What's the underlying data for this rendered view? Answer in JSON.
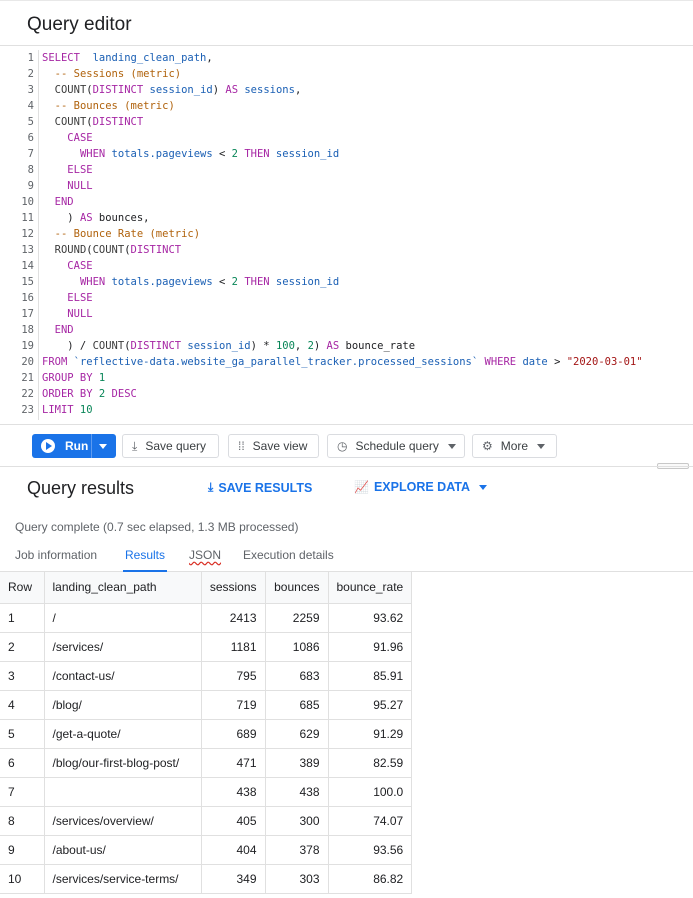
{
  "editor": {
    "title": "Query editor"
  },
  "sql": [
    [
      [
        "k",
        "SELECT"
      ],
      [
        "",
        "  "
      ],
      [
        "id",
        "landing_clean_path"
      ],
      [
        "",
        ","
      ]
    ],
    [
      [
        "",
        "  "
      ],
      [
        "c",
        "-- Sessions (metric)"
      ]
    ],
    [
      [
        "",
        "  "
      ],
      [
        "f",
        "COUNT"
      ],
      [
        "",
        "("
      ],
      [
        "k",
        "DISTINCT"
      ],
      [
        "",
        ""
      ],
      [
        "id",
        " session_id"
      ],
      [
        "",
        ") "
      ],
      [
        "k",
        "AS"
      ],
      [
        "id",
        " sessions"
      ],
      [
        "",
        ","
      ]
    ],
    [
      [
        "",
        "  "
      ],
      [
        "c",
        "-- Bounces (metric)"
      ]
    ],
    [
      [
        "",
        "  "
      ],
      [
        "f",
        "COUNT"
      ],
      [
        "",
        "("
      ],
      [
        "k",
        "DISTINCT"
      ]
    ],
    [
      [
        "",
        "    "
      ],
      [
        "k",
        "CASE"
      ]
    ],
    [
      [
        "",
        "      "
      ],
      [
        "k",
        "WHEN"
      ],
      [
        "id",
        " totals.pageviews"
      ],
      [
        "",
        " < "
      ],
      [
        "n",
        "2"
      ],
      [
        "",
        ""
      ],
      [
        "k",
        " THEN"
      ],
      [
        "id",
        " session_id"
      ]
    ],
    [
      [
        "",
        "    "
      ],
      [
        "k",
        "ELSE"
      ]
    ],
    [
      [
        "",
        "    "
      ],
      [
        "k",
        "NULL"
      ]
    ],
    [
      [
        "",
        "  "
      ],
      [
        "k",
        "END"
      ]
    ],
    [
      [
        "",
        "    ) "
      ],
      [
        "k",
        "AS"
      ],
      [
        "",
        " bounces,"
      ]
    ],
    [
      [
        "",
        "  "
      ],
      [
        "c",
        "-- Bounce Rate (metric)"
      ]
    ],
    [
      [
        "",
        "  "
      ],
      [
        "f",
        "ROUND"
      ],
      [
        "",
        "("
      ],
      [
        "f",
        "COUNT"
      ],
      [
        "",
        "("
      ],
      [
        "k",
        "DISTINCT"
      ]
    ],
    [
      [
        "",
        "    "
      ],
      [
        "k",
        "CASE"
      ]
    ],
    [
      [
        "",
        "      "
      ],
      [
        "k",
        "WHEN"
      ],
      [
        "id",
        " totals.pageviews"
      ],
      [
        "",
        " < "
      ],
      [
        "n",
        "2"
      ],
      [
        "k",
        " THEN"
      ],
      [
        "id",
        " session_id"
      ]
    ],
    [
      [
        "",
        "    "
      ],
      [
        "k",
        "ELSE"
      ]
    ],
    [
      [
        "",
        "    "
      ],
      [
        "k",
        "NULL"
      ]
    ],
    [
      [
        "",
        "  "
      ],
      [
        "k",
        "END"
      ]
    ],
    [
      [
        "",
        "    ) / "
      ],
      [
        "f",
        "COUNT"
      ],
      [
        "",
        "("
      ],
      [
        "k",
        "DISTINCT"
      ],
      [
        "id",
        " session_id"
      ],
      [
        "",
        ") * "
      ],
      [
        "n",
        "100"
      ],
      [
        "",
        ", "
      ],
      [
        "n",
        "2"
      ],
      [
        "",
        ") "
      ],
      [
        "k",
        "AS"
      ],
      [
        "",
        " bounce_rate"
      ]
    ],
    [
      [
        "k",
        "FROM"
      ],
      [
        "s",
        " `reflective-data.website_ga_parallel_tracker.processed_sessions`"
      ],
      [
        "k",
        " WHERE"
      ],
      [
        "id",
        " date"
      ],
      [
        "",
        " > "
      ],
      [
        "t",
        "\"2020-03-01\""
      ]
    ],
    [
      [
        "k",
        "GROUP BY"
      ],
      [
        "n",
        " 1"
      ]
    ],
    [
      [
        "k",
        "ORDER BY"
      ],
      [
        "n",
        " 2"
      ],
      [
        "k",
        " DESC"
      ]
    ],
    [
      [
        "k",
        "LIMIT"
      ],
      [
        "n",
        " 10"
      ]
    ]
  ],
  "toolbar": {
    "run_label": "Run",
    "save_query_label": "Save query",
    "save_view_label": "Save view",
    "schedule_query_label": "Schedule query",
    "more_label": "More"
  },
  "results": {
    "title": "Query results",
    "save_results_label": "SAVE RESULTS",
    "explore_data_label": "EXPLORE DATA",
    "status": "Query complete (0.7 sec elapsed, 1.3 MB processed)",
    "tabs": [
      "Job information",
      "Results",
      "JSON",
      "Execution details"
    ],
    "active_tab": "Results",
    "columns": [
      "Row",
      "landing_clean_path",
      "sessions",
      "bounces",
      "bounce_rate"
    ],
    "rows": [
      [
        "1",
        "/",
        "2413",
        "2259",
        "93.62"
      ],
      [
        "2",
        "/services/",
        "1181",
        "1086",
        "91.96"
      ],
      [
        "3",
        "/contact-us/",
        "795",
        "683",
        "85.91"
      ],
      [
        "4",
        "/blog/",
        "719",
        "685",
        "95.27"
      ],
      [
        "5",
        "/get-a-quote/",
        "689",
        "629",
        "91.29"
      ],
      [
        "6",
        "/blog/our-first-blog-post/",
        "471",
        "389",
        "82.59"
      ],
      [
        "7",
        "",
        "438",
        "438",
        "100.0"
      ],
      [
        "8",
        "/services/overview/",
        "405",
        "300",
        "74.07"
      ],
      [
        "9",
        "/about-us/",
        "404",
        "378",
        "93.56"
      ],
      [
        "10",
        "/services/service-terms/",
        "349",
        "303",
        "86.82"
      ]
    ]
  },
  "icons": {
    "play": "play-icon",
    "save": "download-icon",
    "view": "grid-icon",
    "schedule": "clock-icon",
    "more": "gear-icon",
    "explore": "chart-icon"
  },
  "colors": {
    "accent": "#1a73e8"
  }
}
